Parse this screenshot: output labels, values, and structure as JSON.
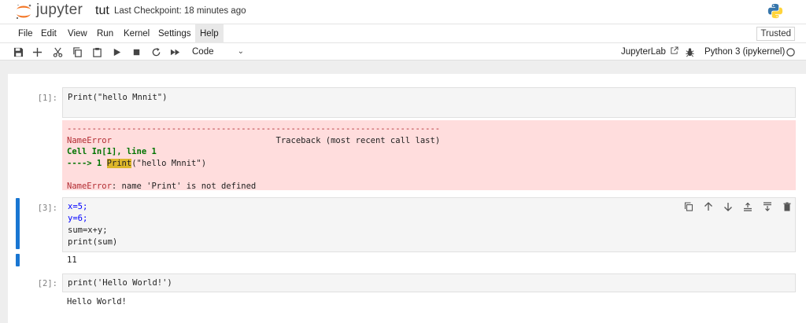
{
  "header": {
    "logo_text": "jupyter",
    "notebook_name": "tut",
    "checkpoint": "Last Checkpoint: 18 minutes ago"
  },
  "menu": {
    "items": [
      "File",
      "Edit",
      "View",
      "Run",
      "Kernel",
      "Settings",
      "Help"
    ],
    "trusted": "Trusted"
  },
  "toolbar": {
    "cell_type": "Code",
    "jupyterlab_label": "JupyterLab",
    "kernel_name": "Python 3 (ipykernel)"
  },
  "cells": [
    {
      "prompt": "[1]:",
      "code_text": "Print(\"hello Mnnit\")",
      "error": {
        "separator": "---------------------------------------------------------------------------",
        "ename": "NameError",
        "traceback_label": "Traceback (most recent call last)",
        "location": "Cell In[1], line 1",
        "arrow": "----> 1 ",
        "line_hl": "Print",
        "line_rest": "(\"hello Mnnit\")",
        "message_name": "NameError",
        "message": ": name 'Print' is not defined"
      }
    },
    {
      "prompt": "[3]:",
      "lines": [
        "x=5;",
        "y=6;",
        "sum=x+y;",
        "print(sum)"
      ],
      "output": "11"
    },
    {
      "prompt": "[2]:",
      "code_text": "print('Hello World!')",
      "output": "Hello World!"
    }
  ],
  "colors": {
    "accent": "#1976d2",
    "error_bg": "#ffdddd",
    "orange": "#f37626"
  }
}
